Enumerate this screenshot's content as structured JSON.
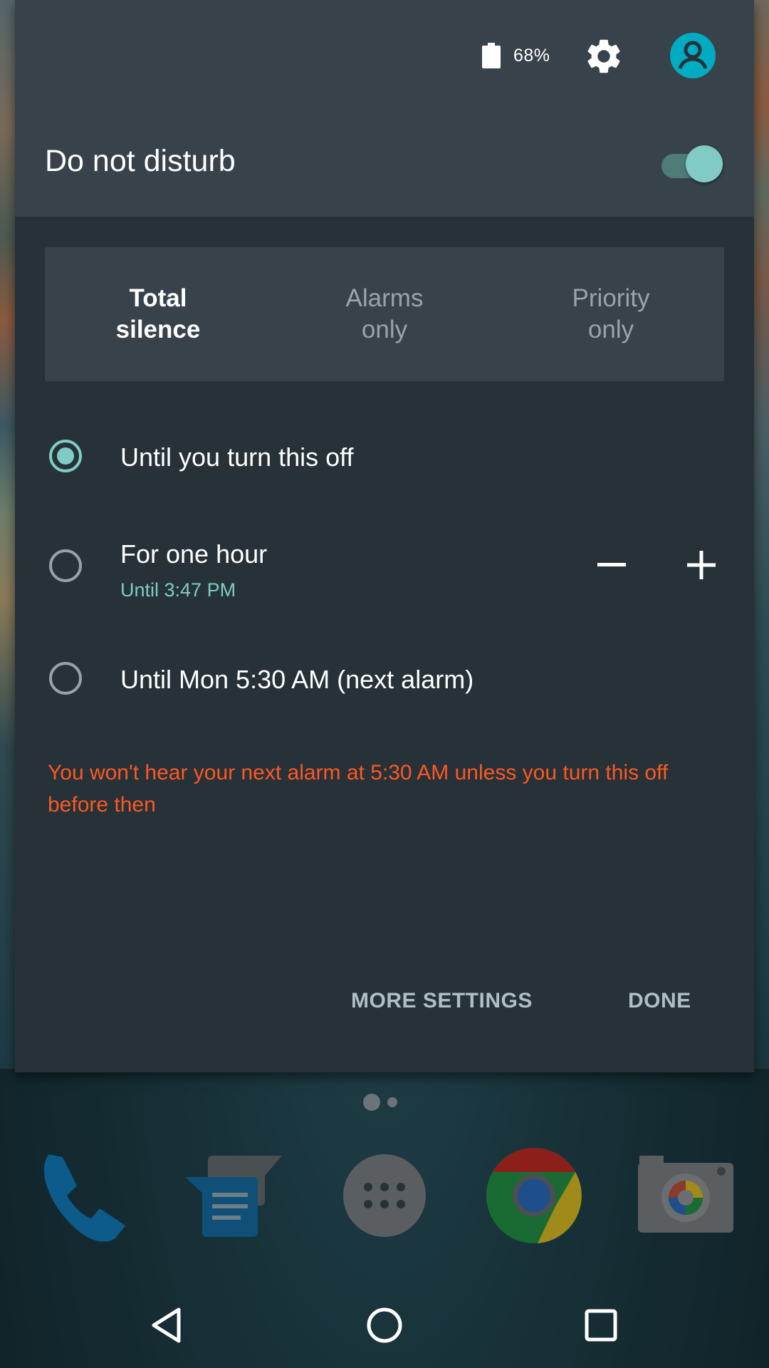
{
  "status": {
    "battery_text": "68%"
  },
  "dnd": {
    "title": "Do not disturb",
    "enabled": true,
    "accent_color": "#80cbc4",
    "modes": [
      {
        "label": "Total\nsilence",
        "selected": true
      },
      {
        "label": "Alarms\nonly",
        "selected": false
      },
      {
        "label": "Priority\nonly",
        "selected": false
      }
    ],
    "options": [
      {
        "label": "Until you turn this off",
        "checked": true
      },
      {
        "label": "For one hour",
        "sublabel": "Until 3:47 PM",
        "checked": false
      },
      {
        "label": "Until Mon 5:30 AM (next alarm)",
        "checked": false
      }
    ],
    "warning": "You won't hear your next alarm at 5:30 AM unless you turn this off before then",
    "warning_color": "#ff5722",
    "more_settings_label": "MORE SETTINGS",
    "done_label": "DONE"
  },
  "home": {
    "page_count": 2,
    "current_page": 1,
    "dock": [
      {
        "icon": "phone-icon"
      },
      {
        "icon": "messenger-icon"
      },
      {
        "icon": "app-drawer-icon"
      },
      {
        "icon": "chrome-icon"
      },
      {
        "icon": "camera-icon"
      }
    ]
  },
  "navbar": {
    "buttons": [
      "back-icon",
      "home-icon",
      "recents-icon"
    ]
  }
}
